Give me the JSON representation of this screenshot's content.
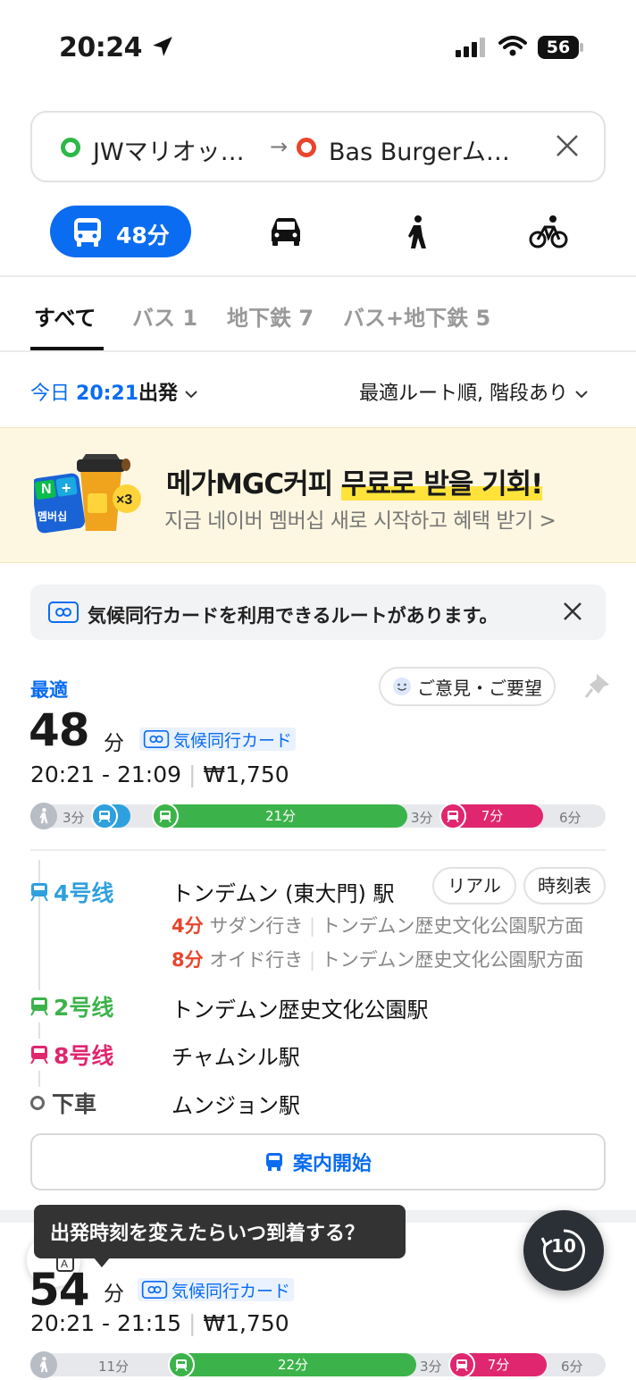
{
  "status_bar": {
    "time": "20:24",
    "battery": "56"
  },
  "search": {
    "origin": "JWマリオッ…",
    "destination": "Bas Burgerム…"
  },
  "modes": [
    {
      "name": "bus",
      "label": "48分",
      "active": true
    },
    {
      "name": "car"
    },
    {
      "name": "walk"
    },
    {
      "name": "bike"
    }
  ],
  "tabs": [
    {
      "label": "すべて",
      "active": true
    },
    {
      "label": "バス",
      "count": "1"
    },
    {
      "label": "地下鉄",
      "count": "7"
    },
    {
      "label": "バス+地下鉄",
      "count": "5"
    }
  ],
  "filter": {
    "prefix": "今日",
    "time": "20:21",
    "suffix": "出発",
    "sort": "最適ルート順, 階段あり"
  },
  "ad": {
    "line1_a": "메가MGC커피",
    "line1_b": "무료로 받을 기회!",
    "line2": "지금 네이버 멤버십 새로 시작하고 혜택 받기 >",
    "badge": "×3",
    "mini": "멤버십"
  },
  "notice": {
    "text": "気候同行カードを利用できるルートがあります。"
  },
  "route1": {
    "tag": "最適",
    "feedback": "ご意見・ご要望",
    "duration": "48",
    "unit": "分",
    "card": "気候同行カード",
    "time_range": "20:21 - 21:09",
    "fare": "₩1,750",
    "timeline": {
      "walk": "3分",
      "line2": "21分",
      "transfer": "3分",
      "line8": "7分",
      "end": "6分"
    },
    "btn_realtime": "リアル",
    "btn_timetable": "時刻表",
    "legs": [
      {
        "line": "4号线",
        "station": "トンデムン (東大門) 駅",
        "color": "#2fa0de"
      },
      {
        "line": "2号线",
        "station": "トンデムン歴史文化公園駅",
        "color": "#3cb34a"
      },
      {
        "line": "8号线",
        "station": "チャムシル駅",
        "color": "#e0266f"
      },
      {
        "line": "下車",
        "station": "ムンジョン駅",
        "color": "#555555"
      }
    ],
    "arrivals": [
      {
        "minutes": "4分",
        "dest": "サダン行き",
        "dir": "トンデムン歴史文化公園駅方面"
      },
      {
        "minutes": "8分",
        "dest": "オイド行き",
        "dir": "トンデムン歴史文化公園駅方面"
      }
    ],
    "guide": "案内開始"
  },
  "tooltip": "出発時刻を変えたらいつ到着する？",
  "fab": "10",
  "route2": {
    "duration": "54",
    "unit": "分",
    "card": "気候同行カード",
    "time_range": "20:21 - 21:15",
    "fare": "₩1,750",
    "timeline": {
      "walk": "11分",
      "line2": "22分",
      "transfer": "3分",
      "line8": "7分",
      "end": "6分"
    }
  },
  "colors": {
    "accent": "#0a6cf0",
    "line4": "#2fa0de",
    "line2": "#3cb34a",
    "line8": "#e0266f",
    "arrival": "#e8452c"
  }
}
